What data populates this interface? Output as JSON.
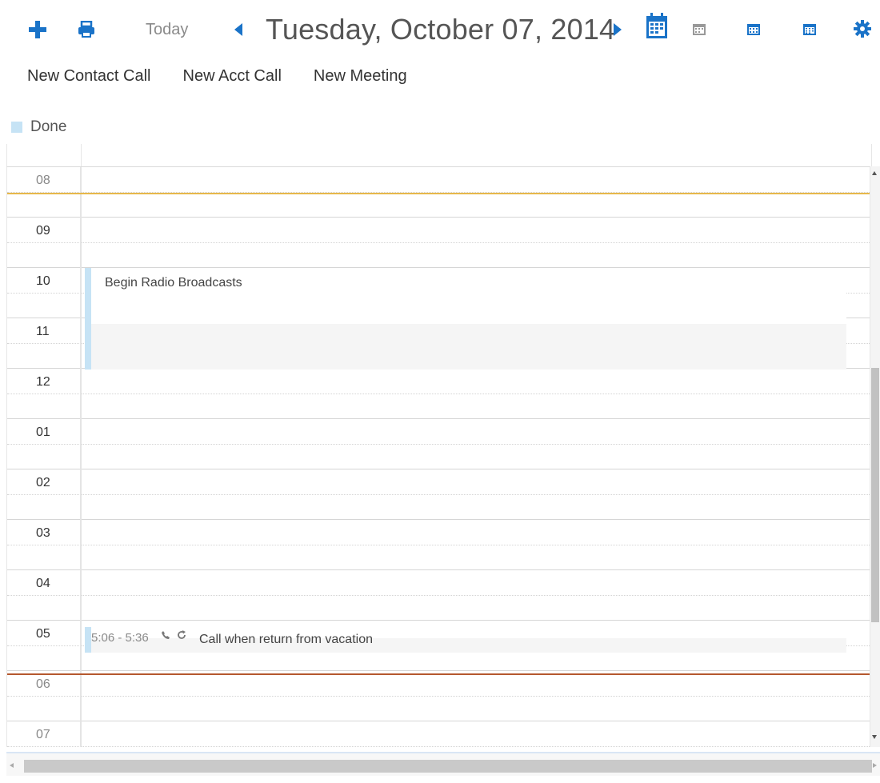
{
  "toolbar": {
    "today_label": "Today",
    "date_title": "Tuesday, October 07, 2014",
    "icons": [
      "add-icon",
      "print-icon",
      "prev-icon",
      "next-icon",
      "day-view-icon",
      "workweek-view-icon",
      "week-view-icon",
      "month-view-icon",
      "gear-icon"
    ]
  },
  "actions": [
    "New Contact Call",
    "New Acct Call",
    "New Meeting"
  ],
  "legend": {
    "label": "Done",
    "color": "#c6e3f5"
  },
  "hours": [
    "08",
    "09",
    "10",
    "11",
    "12",
    "01",
    "02",
    "03",
    "04",
    "05",
    "06",
    "07"
  ],
  "events": [
    {
      "title": "Begin Radio Broadcasts",
      "time": ""
    },
    {
      "title": "Call when return from vacation",
      "time": "5:06 - 5:36"
    }
  ],
  "colors": {
    "accent": "#1a73c8",
    "done": "#c6e3f5",
    "current_time_line": "#e7b84a",
    "end_line": "#b5582e"
  }
}
